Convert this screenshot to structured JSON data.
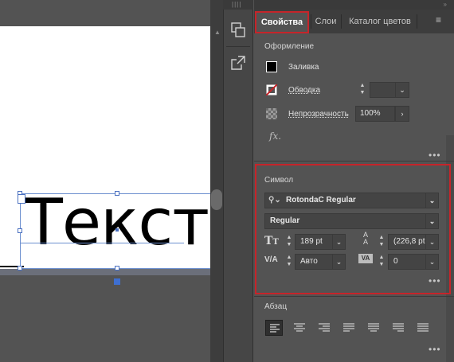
{
  "canvas": {
    "text": "Текст"
  },
  "tabs": {
    "properties": "Свойства",
    "layers": "Слои",
    "swatches": "Каталог цветов"
  },
  "appearance": {
    "title": "Оформление",
    "fill_label": "Заливка",
    "stroke_label": "Обводка",
    "opacity_label": "Непрозрачность",
    "opacity_value": "100%",
    "fx_label": "fx."
  },
  "character": {
    "title": "Символ",
    "font_family": "RotondaC Regular",
    "font_style": "Regular",
    "font_size": "189 pt",
    "leading": "(226,8 pt",
    "kerning": "Авто",
    "tracking": "0"
  },
  "paragraph": {
    "title": "Абзац"
  },
  "more": "•••",
  "colors": {
    "accent_highlight": "#c6242a",
    "panel_bg": "#535353",
    "selection": "#4a70c0"
  },
  "icons": [
    "arrange-panels-icon",
    "export-icon",
    "search-icon",
    "chevron-down-icon",
    "font-size-icon",
    "leading-icon",
    "kerning-icon",
    "tracking-icon",
    "align-left-icon",
    "align-center-icon",
    "align-right-icon",
    "justify-left-icon",
    "justify-center-icon",
    "justify-right-icon",
    "justify-all-icon"
  ]
}
